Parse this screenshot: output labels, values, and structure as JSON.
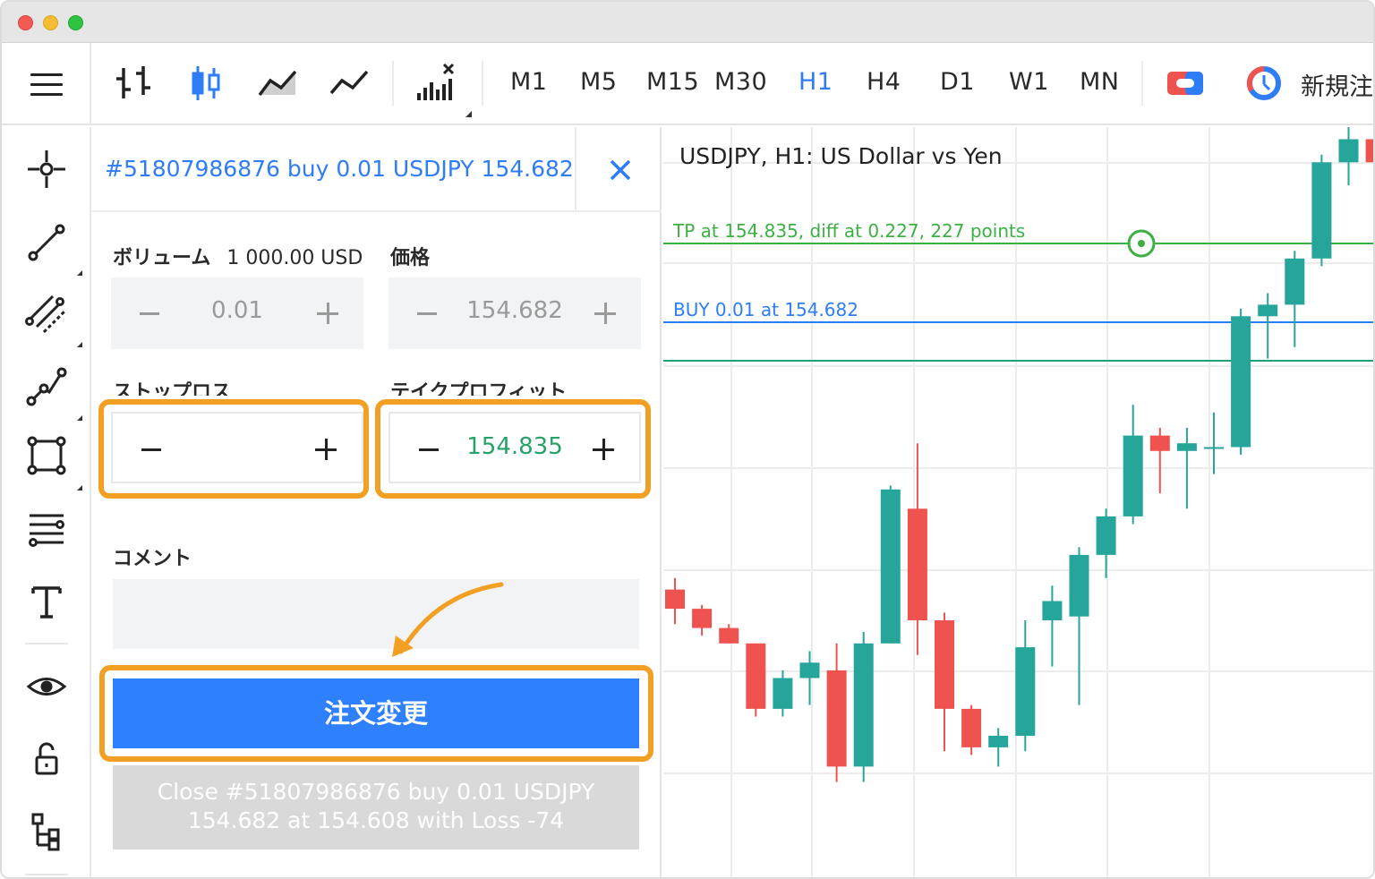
{
  "toolbar": {
    "timeframes": [
      "M1",
      "M5",
      "M15",
      "M30",
      "H1",
      "H4",
      "D1",
      "W1",
      "MN"
    ],
    "active_timeframe": "H1",
    "new_order_label": "新規注"
  },
  "panel": {
    "title": "#51807986876 buy 0.01 USDJPY 154.682",
    "volume_label": "ボリューム",
    "volume_sub": "1 000.00 USD",
    "volume_value": "0.01",
    "price_label": "価格",
    "price_value": "154.682",
    "stoploss_label": "ストップロス",
    "stoploss_value": "",
    "takeprofit_label": "テイクプロフィット",
    "takeprofit_value": "154.835",
    "comment_label": "コメント",
    "comment_value": "",
    "submit_label": "注文変更",
    "close_line1": "Close #51807986876 buy 0.01 USDJPY",
    "close_line2": "154.682 at 154.608 with Loss -74"
  },
  "chart": {
    "title": "USDJPY, H1: US Dollar vs Yen",
    "tp_label": "TP at 154.835, diff at 0.227, 227 points",
    "buy_label": "BUY 0.01 at 154.682",
    "colors": {
      "up": "#26a69a",
      "down": "#ef5350",
      "tp": "#3cb043",
      "buy": "#2f7df6",
      "price": "#1f9f7a",
      "accent": "#f2a023"
    }
  },
  "chart_data": {
    "type": "candlestick",
    "title": "USDJPY, H1: US Dollar vs Yen",
    "lines": [
      {
        "name": "TP",
        "value": 154.835
      },
      {
        "name": "BUY",
        "value": 154.682
      }
    ],
    "candles_pixel_note": "",
    "candles": [
      {
        "o": 0.38,
        "c": 0.33,
        "h": 0.41,
        "l": 0.29
      },
      {
        "o": 0.33,
        "c": 0.28,
        "h": 0.34,
        "l": 0.26
      },
      {
        "o": 0.28,
        "c": 0.24,
        "h": 0.29,
        "l": 0.24
      },
      {
        "o": 0.24,
        "c": 0.07,
        "h": 0.24,
        "l": 0.05
      },
      {
        "o": 0.07,
        "c": 0.15,
        "h": 0.17,
        "l": 0.05
      },
      {
        "o": 0.15,
        "c": 0.19,
        "h": 0.22,
        "l": 0.08
      },
      {
        "o": 0.17,
        "c": -0.08,
        "h": 0.24,
        "l": -0.12
      },
      {
        "o": -0.08,
        "c": 0.24,
        "h": 0.27,
        "l": -0.12
      },
      {
        "o": 0.24,
        "c": 0.64,
        "h": 0.65,
        "l": 0.24
      },
      {
        "o": 0.59,
        "c": 0.3,
        "h": 0.76,
        "l": 0.21
      },
      {
        "o": 0.3,
        "c": 0.07,
        "h": 0.32,
        "l": -0.04
      },
      {
        "o": 0.07,
        "c": -0.03,
        "h": 0.08,
        "l": -0.05
      },
      {
        "o": -0.03,
        "c": 0.0,
        "h": 0.02,
        "l": -0.08
      },
      {
        "o": 0.0,
        "c": 0.23,
        "h": 0.3,
        "l": -0.04
      },
      {
        "o": 0.3,
        "c": 0.35,
        "h": 0.39,
        "l": 0.18
      },
      {
        "o": 0.31,
        "c": 0.47,
        "h": 0.49,
        "l": 0.08
      },
      {
        "o": 0.47,
        "c": 0.57,
        "h": 0.59,
        "l": 0.41
      },
      {
        "o": 0.57,
        "c": 0.78,
        "h": 0.86,
        "l": 0.55
      },
      {
        "o": 0.78,
        "c": 0.74,
        "h": 0.8,
        "l": 0.63
      },
      {
        "o": 0.74,
        "c": 0.76,
        "h": 0.8,
        "l": 0.59
      },
      {
        "o": 0.75,
        "c": 0.75,
        "h": 0.84,
        "l": 0.68
      },
      {
        "o": 0.75,
        "c": 1.09,
        "h": 1.11,
        "l": 0.73
      },
      {
        "o": 1.09,
        "c": 1.12,
        "h": 1.15,
        "l": 0.98
      },
      {
        "o": 1.12,
        "c": 1.24,
        "h": 1.26,
        "l": 1.01
      },
      {
        "o": 1.24,
        "c": 1.49,
        "h": 1.51,
        "l": 1.22
      },
      {
        "o": 1.49,
        "c": 1.55,
        "h": 1.69,
        "l": 1.43
      },
      {
        "o": 1.55,
        "c": 1.49,
        "h": 1.63,
        "l": 1.48
      },
      {
        "o": 1.49,
        "c": 1.51,
        "h": 1.57,
        "l": 1.46
      }
    ]
  }
}
